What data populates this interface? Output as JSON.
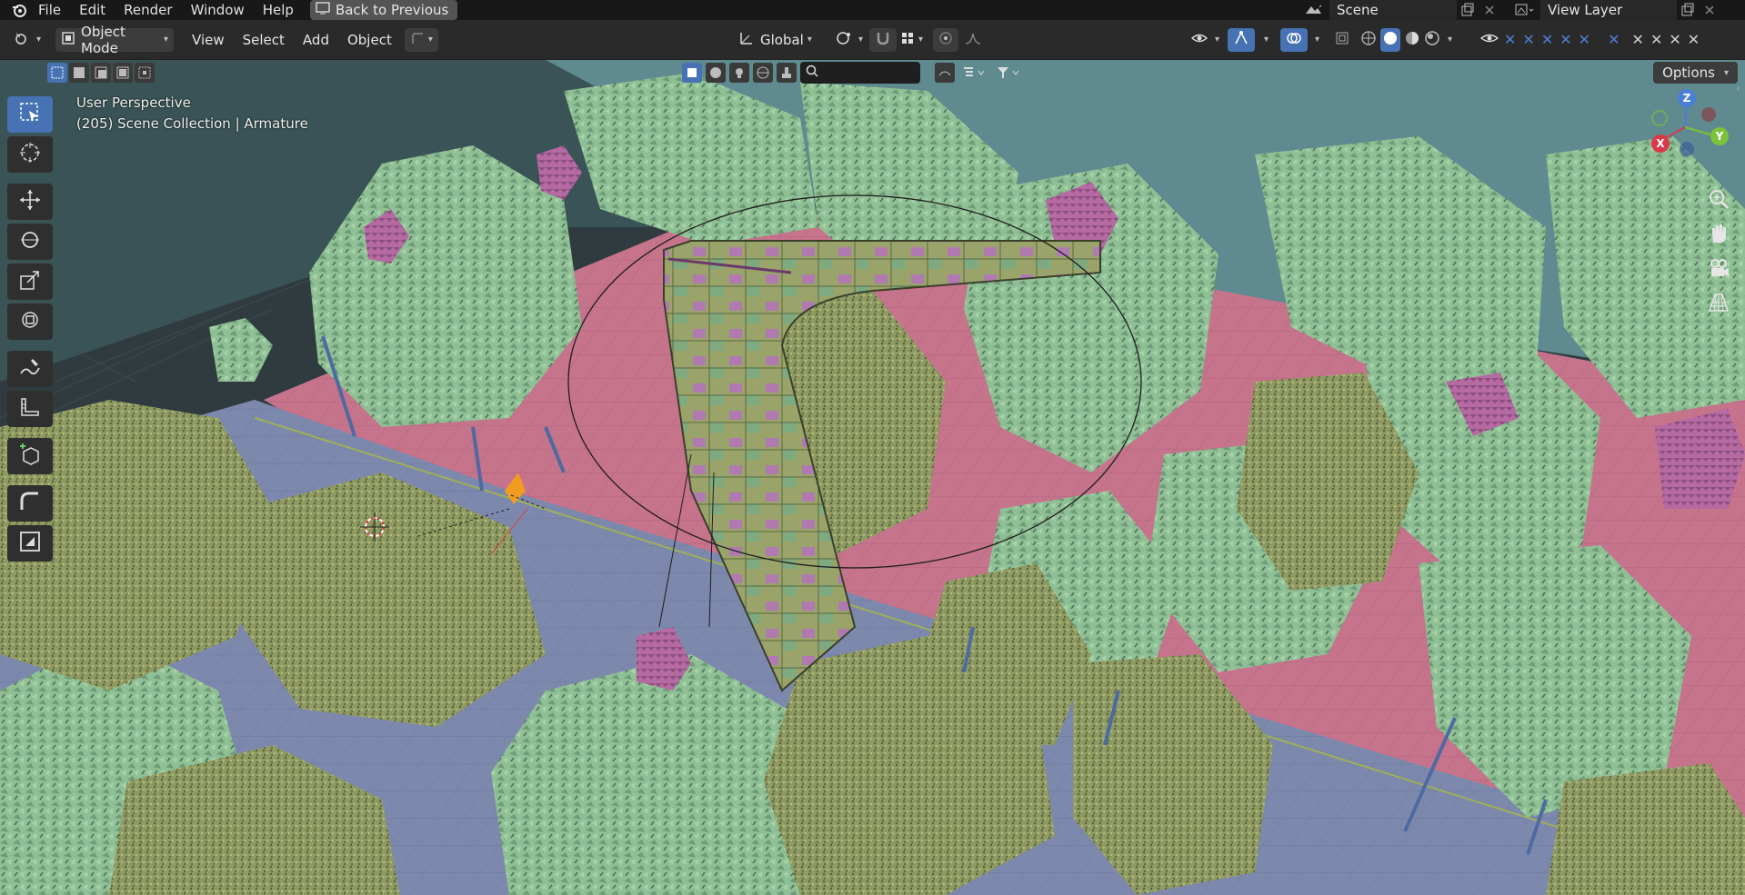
{
  "menu": {
    "items": [
      "File",
      "Edit",
      "Render",
      "Window",
      "Help"
    ],
    "back_button": "Back to Previous"
  },
  "scene": {
    "name": "Scene",
    "view_layer": "View Layer"
  },
  "header": {
    "mode": "Object Mode",
    "menus": [
      "View",
      "Select",
      "Add",
      "Object"
    ],
    "transform_orientation": "Global"
  },
  "toolbar2": {
    "search_placeholder": "",
    "options_label": "Options"
  },
  "viewport": {
    "perspective": "User Perspective",
    "collection_info": "(205) Scene Collection | Armature"
  },
  "gizmo": {
    "x": "X",
    "y": "Y",
    "z": "Z"
  },
  "colors": {
    "accent": "#4772b3",
    "trees_light": "#8fc49a",
    "trees_dark": "#7f8f5a",
    "road": "#7f8ab0",
    "sidewalk": "#c7758e",
    "ground": "#5e8a90",
    "blossom": "#b86fa8"
  },
  "icons": {
    "tools": [
      "select-box-icon",
      "cursor-icon",
      "move-icon",
      "rotate-icon",
      "scale-icon",
      "transform-icon",
      "annotate-icon",
      "measure-icon",
      "add-cube-icon",
      "shear-icon",
      "inset-icon"
    ],
    "nav": [
      "zoom-icon",
      "hand-icon",
      "camera-icon",
      "grid-icon"
    ]
  }
}
